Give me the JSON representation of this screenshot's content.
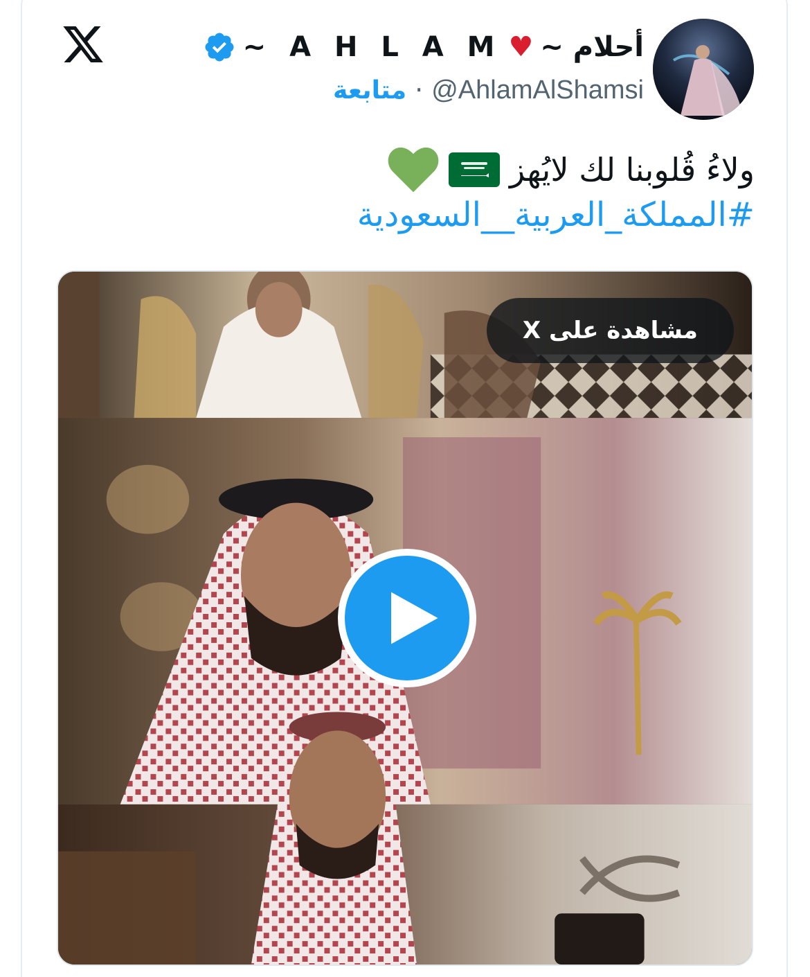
{
  "author": {
    "display_name_arabic": "أحلام ~",
    "display_name_latin": "~ A H L A M",
    "heart_emoji": "♥",
    "verified": true,
    "handle": "@AhlamAlShamsi",
    "separator": "·",
    "follow_label": "متابعة"
  },
  "tweet": {
    "text": "ولاءُ قُلوبنا لك لايُهز",
    "flag_emoji": "saudi-flag-icon",
    "heart_emoji": "green-heart-icon",
    "hashtag": "#المملكة_العربية__السعودية"
  },
  "media": {
    "watch_label": "مشاهدة على X",
    "play_icon": "play-icon"
  },
  "colors": {
    "accent": "#1d9bf0",
    "text": "#0f1419",
    "secondary": "#536471",
    "heart_red": "#d91f2f",
    "heart_green": "#78b159",
    "flag_green": "#006c35"
  }
}
